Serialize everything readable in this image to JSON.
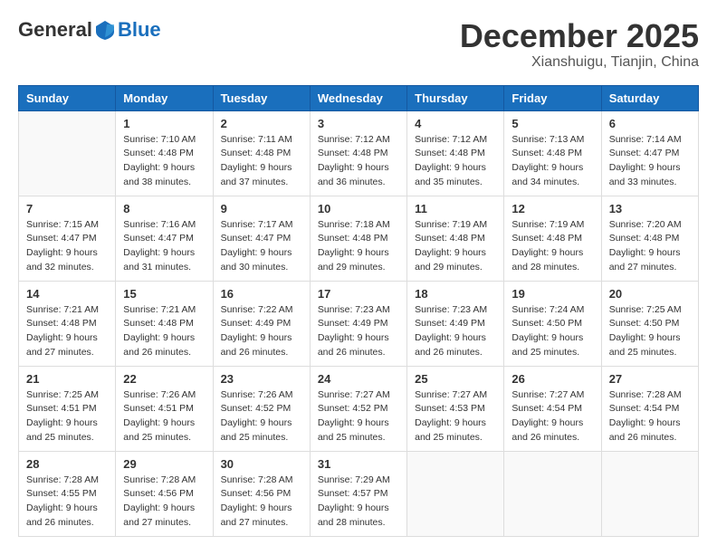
{
  "logo": {
    "general": "General",
    "blue": "Blue"
  },
  "header": {
    "month": "December 2025",
    "location": "Xianshuigu, Tianjin, China"
  },
  "weekdays": [
    "Sunday",
    "Monday",
    "Tuesday",
    "Wednesday",
    "Thursday",
    "Friday",
    "Saturday"
  ],
  "weeks": [
    [
      {
        "day": "",
        "sunrise": "",
        "sunset": "",
        "daylight": ""
      },
      {
        "day": "1",
        "sunrise": "Sunrise: 7:10 AM",
        "sunset": "Sunset: 4:48 PM",
        "daylight": "Daylight: 9 hours and 38 minutes."
      },
      {
        "day": "2",
        "sunrise": "Sunrise: 7:11 AM",
        "sunset": "Sunset: 4:48 PM",
        "daylight": "Daylight: 9 hours and 37 minutes."
      },
      {
        "day": "3",
        "sunrise": "Sunrise: 7:12 AM",
        "sunset": "Sunset: 4:48 PM",
        "daylight": "Daylight: 9 hours and 36 minutes."
      },
      {
        "day": "4",
        "sunrise": "Sunrise: 7:12 AM",
        "sunset": "Sunset: 4:48 PM",
        "daylight": "Daylight: 9 hours and 35 minutes."
      },
      {
        "day": "5",
        "sunrise": "Sunrise: 7:13 AM",
        "sunset": "Sunset: 4:48 PM",
        "daylight": "Daylight: 9 hours and 34 minutes."
      },
      {
        "day": "6",
        "sunrise": "Sunrise: 7:14 AM",
        "sunset": "Sunset: 4:47 PM",
        "daylight": "Daylight: 9 hours and 33 minutes."
      }
    ],
    [
      {
        "day": "7",
        "sunrise": "Sunrise: 7:15 AM",
        "sunset": "Sunset: 4:47 PM",
        "daylight": "Daylight: 9 hours and 32 minutes."
      },
      {
        "day": "8",
        "sunrise": "Sunrise: 7:16 AM",
        "sunset": "Sunset: 4:47 PM",
        "daylight": "Daylight: 9 hours and 31 minutes."
      },
      {
        "day": "9",
        "sunrise": "Sunrise: 7:17 AM",
        "sunset": "Sunset: 4:47 PM",
        "daylight": "Daylight: 9 hours and 30 minutes."
      },
      {
        "day": "10",
        "sunrise": "Sunrise: 7:18 AM",
        "sunset": "Sunset: 4:48 PM",
        "daylight": "Daylight: 9 hours and 29 minutes."
      },
      {
        "day": "11",
        "sunrise": "Sunrise: 7:19 AM",
        "sunset": "Sunset: 4:48 PM",
        "daylight": "Daylight: 9 hours and 29 minutes."
      },
      {
        "day": "12",
        "sunrise": "Sunrise: 7:19 AM",
        "sunset": "Sunset: 4:48 PM",
        "daylight": "Daylight: 9 hours and 28 minutes."
      },
      {
        "day": "13",
        "sunrise": "Sunrise: 7:20 AM",
        "sunset": "Sunset: 4:48 PM",
        "daylight": "Daylight: 9 hours and 27 minutes."
      }
    ],
    [
      {
        "day": "14",
        "sunrise": "Sunrise: 7:21 AM",
        "sunset": "Sunset: 4:48 PM",
        "daylight": "Daylight: 9 hours and 27 minutes."
      },
      {
        "day": "15",
        "sunrise": "Sunrise: 7:21 AM",
        "sunset": "Sunset: 4:48 PM",
        "daylight": "Daylight: 9 hours and 26 minutes."
      },
      {
        "day": "16",
        "sunrise": "Sunrise: 7:22 AM",
        "sunset": "Sunset: 4:49 PM",
        "daylight": "Daylight: 9 hours and 26 minutes."
      },
      {
        "day": "17",
        "sunrise": "Sunrise: 7:23 AM",
        "sunset": "Sunset: 4:49 PM",
        "daylight": "Daylight: 9 hours and 26 minutes."
      },
      {
        "day": "18",
        "sunrise": "Sunrise: 7:23 AM",
        "sunset": "Sunset: 4:49 PM",
        "daylight": "Daylight: 9 hours and 26 minutes."
      },
      {
        "day": "19",
        "sunrise": "Sunrise: 7:24 AM",
        "sunset": "Sunset: 4:50 PM",
        "daylight": "Daylight: 9 hours and 25 minutes."
      },
      {
        "day": "20",
        "sunrise": "Sunrise: 7:25 AM",
        "sunset": "Sunset: 4:50 PM",
        "daylight": "Daylight: 9 hours and 25 minutes."
      }
    ],
    [
      {
        "day": "21",
        "sunrise": "Sunrise: 7:25 AM",
        "sunset": "Sunset: 4:51 PM",
        "daylight": "Daylight: 9 hours and 25 minutes."
      },
      {
        "day": "22",
        "sunrise": "Sunrise: 7:26 AM",
        "sunset": "Sunset: 4:51 PM",
        "daylight": "Daylight: 9 hours and 25 minutes."
      },
      {
        "day": "23",
        "sunrise": "Sunrise: 7:26 AM",
        "sunset": "Sunset: 4:52 PM",
        "daylight": "Daylight: 9 hours and 25 minutes."
      },
      {
        "day": "24",
        "sunrise": "Sunrise: 7:27 AM",
        "sunset": "Sunset: 4:52 PM",
        "daylight": "Daylight: 9 hours and 25 minutes."
      },
      {
        "day": "25",
        "sunrise": "Sunrise: 7:27 AM",
        "sunset": "Sunset: 4:53 PM",
        "daylight": "Daylight: 9 hours and 25 minutes."
      },
      {
        "day": "26",
        "sunrise": "Sunrise: 7:27 AM",
        "sunset": "Sunset: 4:54 PM",
        "daylight": "Daylight: 9 hours and 26 minutes."
      },
      {
        "day": "27",
        "sunrise": "Sunrise: 7:28 AM",
        "sunset": "Sunset: 4:54 PM",
        "daylight": "Daylight: 9 hours and 26 minutes."
      }
    ],
    [
      {
        "day": "28",
        "sunrise": "Sunrise: 7:28 AM",
        "sunset": "Sunset: 4:55 PM",
        "daylight": "Daylight: 9 hours and 26 minutes."
      },
      {
        "day": "29",
        "sunrise": "Sunrise: 7:28 AM",
        "sunset": "Sunset: 4:56 PM",
        "daylight": "Daylight: 9 hours and 27 minutes."
      },
      {
        "day": "30",
        "sunrise": "Sunrise: 7:28 AM",
        "sunset": "Sunset: 4:56 PM",
        "daylight": "Daylight: 9 hours and 27 minutes."
      },
      {
        "day": "31",
        "sunrise": "Sunrise: 7:29 AM",
        "sunset": "Sunset: 4:57 PM",
        "daylight": "Daylight: 9 hours and 28 minutes."
      },
      {
        "day": "",
        "sunrise": "",
        "sunset": "",
        "daylight": ""
      },
      {
        "day": "",
        "sunrise": "",
        "sunset": "",
        "daylight": ""
      },
      {
        "day": "",
        "sunrise": "",
        "sunset": "",
        "daylight": ""
      }
    ]
  ]
}
